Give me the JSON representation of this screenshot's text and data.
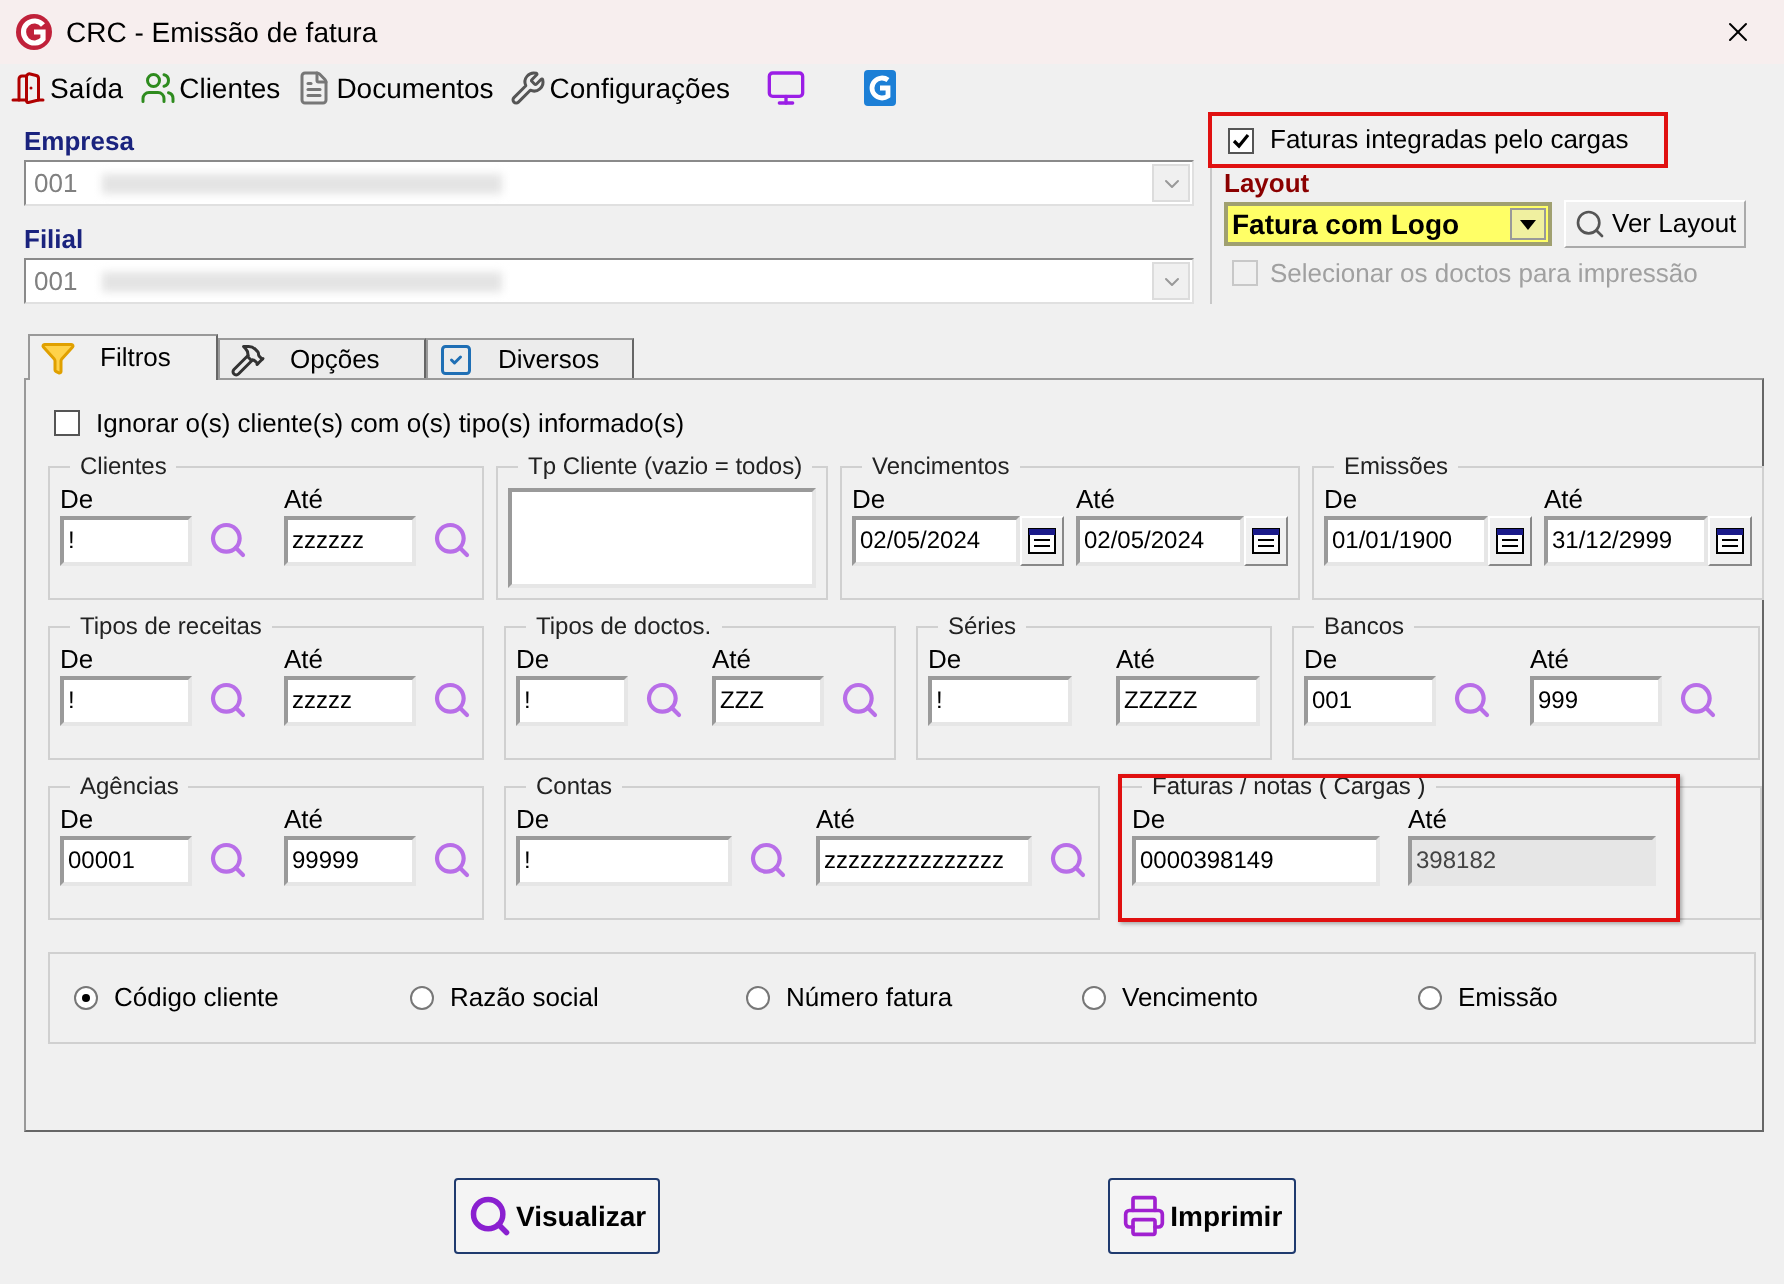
{
  "window": {
    "title": "CRC - Emissão de fatura"
  },
  "toolbar": [
    {
      "kind": "exit",
      "label": "Saída"
    },
    {
      "kind": "clients",
      "label": "Clientes"
    },
    {
      "kind": "documents",
      "label": "Documentos"
    },
    {
      "kind": "settings",
      "label": "Configurações"
    },
    {
      "kind": "monitor"
    },
    {
      "kind": "app"
    }
  ],
  "empresa": {
    "label": "Empresa",
    "value": "001"
  },
  "filial": {
    "label": "Filial",
    "value": "001"
  },
  "options": {
    "cargas": {
      "label": "Faturas integradas pelo cargas",
      "checked": true,
      "highlighted": true
    },
    "layout": {
      "label": "Layout",
      "value": "Fatura com Logo"
    },
    "ver_layout": "Ver Layout",
    "select_docs": {
      "label": "Selecionar os doctos para impressão",
      "checked": false,
      "disabled": true
    }
  },
  "tabs": [
    {
      "kind": "funnel",
      "label": "Filtros",
      "selected": true
    },
    {
      "kind": "tools",
      "label": "Opções",
      "selected": false
    },
    {
      "kind": "check",
      "label": "Diversos",
      "selected": false
    }
  ],
  "ignore": {
    "label": "Ignorar o(s) cliente(s) com o(s) tipo(s) informado(s)",
    "checked": false
  },
  "group_rows": [
    [
      {
        "kind": "range",
        "title": "Clientes",
        "fields": [
          {
            "label": "De",
            "value": "!",
            "lookup": true
          },
          {
            "label": "Até",
            "value": "zzzzzz",
            "lookup": true
          }
        ]
      },
      {
        "kind": "list",
        "title": "Tp Cliente (vazio = todos)"
      },
      {
        "kind": "date",
        "title": "Vencimentos",
        "fields": [
          {
            "label": "De",
            "value": "02/05/2024"
          },
          {
            "label": "Até",
            "value": "02/05/2024"
          }
        ]
      },
      {
        "kind": "date",
        "title": "Emissões",
        "fields": [
          {
            "label": "De",
            "value": "01/01/1900"
          },
          {
            "label": "Até",
            "value": "31/12/2999"
          }
        ]
      }
    ],
    [
      {
        "kind": "range",
        "title": "Tipos de receitas",
        "fields": [
          {
            "label": "De",
            "value": "!",
            "lookup": true
          },
          {
            "label": "Até",
            "value": "zzzzz",
            "lookup": true
          }
        ]
      },
      {
        "kind": "range",
        "title": "Tipos de doctos.",
        "fields": [
          {
            "label": "De",
            "value": "!",
            "lookup": true
          },
          {
            "label": "Até",
            "value": "ZZZ",
            "lookup": true
          }
        ]
      },
      {
        "kind": "range",
        "title": "Séries",
        "fields": [
          {
            "label": "De",
            "value": "!",
            "lookup": false
          },
          {
            "label": "Até",
            "value": "ZZZZZ",
            "lookup": false
          }
        ]
      },
      {
        "kind": "range",
        "title": "Bancos",
        "fields": [
          {
            "label": "De",
            "value": "001",
            "lookup": true
          },
          {
            "label": "Até",
            "value": "999",
            "lookup": true
          }
        ]
      }
    ],
    [
      {
        "kind": "range",
        "title": "Agências",
        "fields": [
          {
            "label": "De",
            "value": "00001",
            "lookup": true
          },
          {
            "label": "Até",
            "value": "99999",
            "lookup": true
          }
        ]
      },
      {
        "kind": "range",
        "title": "Contas",
        "fields": [
          {
            "label": "De",
            "value": "!",
            "lookup": true
          },
          {
            "label": "Até",
            "value": "zzzzzzzzzzzzzzz",
            "lookup": true
          }
        ]
      },
      {
        "kind": "range",
        "title": "Faturas / notas ( Cargas )",
        "highlighted": true,
        "fields": [
          {
            "label": "De",
            "value": "0000398149",
            "lookup": false
          },
          {
            "label": "Até",
            "value": "398182",
            "lookup": false,
            "disabled": true
          }
        ]
      }
    ]
  ],
  "sort_options": [
    {
      "label": "Código cliente",
      "selected": true
    },
    {
      "label": "Razão social",
      "selected": false
    },
    {
      "label": "Número fatura",
      "selected": false
    },
    {
      "label": "Vencimento",
      "selected": false
    },
    {
      "label": "Emissão",
      "selected": false
    }
  ],
  "buttons": [
    {
      "kind": "preview",
      "label": "Visualizar"
    },
    {
      "kind": "print",
      "label": "Imprimir"
    }
  ]
}
